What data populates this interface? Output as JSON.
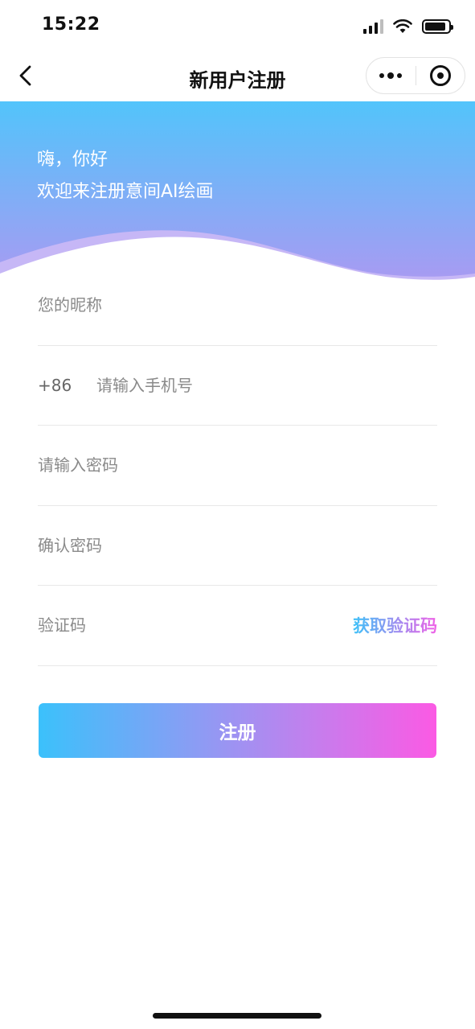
{
  "status_bar": {
    "time": "15:22",
    "battery_level": 0.9
  },
  "nav": {
    "title": "新用户注册"
  },
  "banner": {
    "greeting": "嗨，你好",
    "welcome": "欢迎来注册意间AI绘画"
  },
  "form": {
    "nickname": {
      "placeholder": "您的昵称",
      "value": ""
    },
    "phone": {
      "prefix": "+86",
      "placeholder": "请输入手机号",
      "value": ""
    },
    "password": {
      "placeholder": "请输入密码",
      "value": ""
    },
    "confirm_password": {
      "placeholder": "确认密码",
      "value": ""
    },
    "verification_code": {
      "placeholder": "验证码",
      "value": "",
      "get_code_label": "获取验证码"
    }
  },
  "submit": {
    "label": "注册"
  },
  "colors": {
    "gradient_start": "#3bc1fb",
    "gradient_end": "#fb5ae4",
    "banner_top": "#52c4fb",
    "banner_bottom": "#a99af2"
  }
}
